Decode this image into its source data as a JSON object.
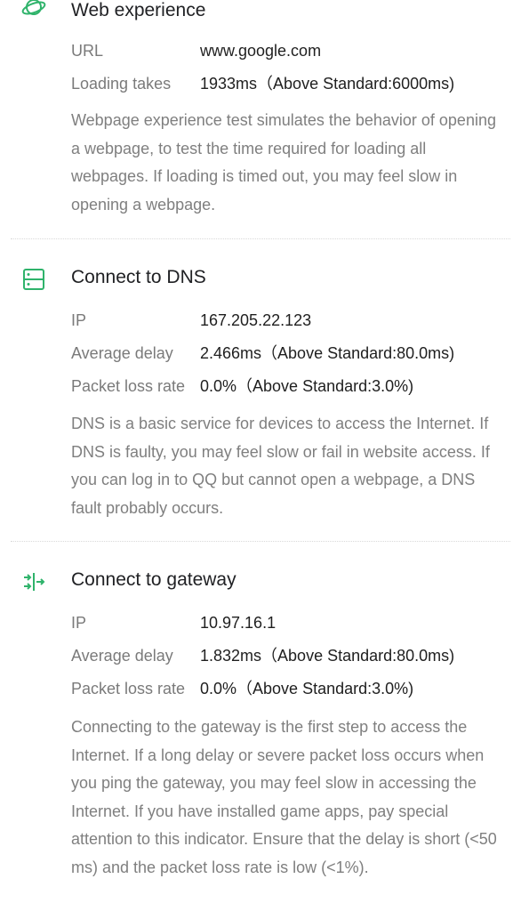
{
  "sections": [
    {
      "title": "Web experience",
      "icon": "planet-icon",
      "rows": [
        {
          "label": "URL",
          "value": "www.google.com"
        },
        {
          "label": "Loading takes",
          "value": "1933ms（Above Standard:6000ms)"
        }
      ],
      "description": "Webpage experience test simulates the behavior of opening a webpage, to test the time required for loading all webpages. If loading is timed out, you may feel slow in opening a webpage."
    },
    {
      "title": "Connect to DNS",
      "icon": "server-icon",
      "rows": [
        {
          "label": "IP",
          "value": "167.205.22.123"
        },
        {
          "label": "Average delay",
          "value": "2.466ms（Above Standard:80.0ms)"
        },
        {
          "label": "Packet loss rate",
          "value": "0.0%（Above Standard:3.0%)"
        }
      ],
      "description": "DNS is a basic service for devices to access the Internet. If DNS is faulty, you may feel slow or fail in website access. If you can log in to QQ but cannot open a webpage, a DNS fault probably occurs."
    },
    {
      "title": "Connect to gateway",
      "icon": "gateway-icon",
      "rows": [
        {
          "label": "IP",
          "value": "10.97.16.1"
        },
        {
          "label": "Average delay",
          "value": "1.832ms（Above Standard:80.0ms)"
        },
        {
          "label": "Packet loss rate",
          "value": "0.0%（Above Standard:3.0%)"
        }
      ],
      "description": "Connecting to the gateway is the first step to access the Internet. If a long delay or severe packet loss occurs when you ping the gateway, you may feel slow in accessing the Internet. If you have installed game apps, pay special attention to this indicator. Ensure that the delay is short (<50 ms) and the packet loss rate is low (<1%)."
    }
  ],
  "colors": {
    "accent": "#2fb36b",
    "label": "#7a7a7a",
    "text": "#1f1f1f",
    "description": "#7f7f7f",
    "divider": "#d9d9d9"
  }
}
